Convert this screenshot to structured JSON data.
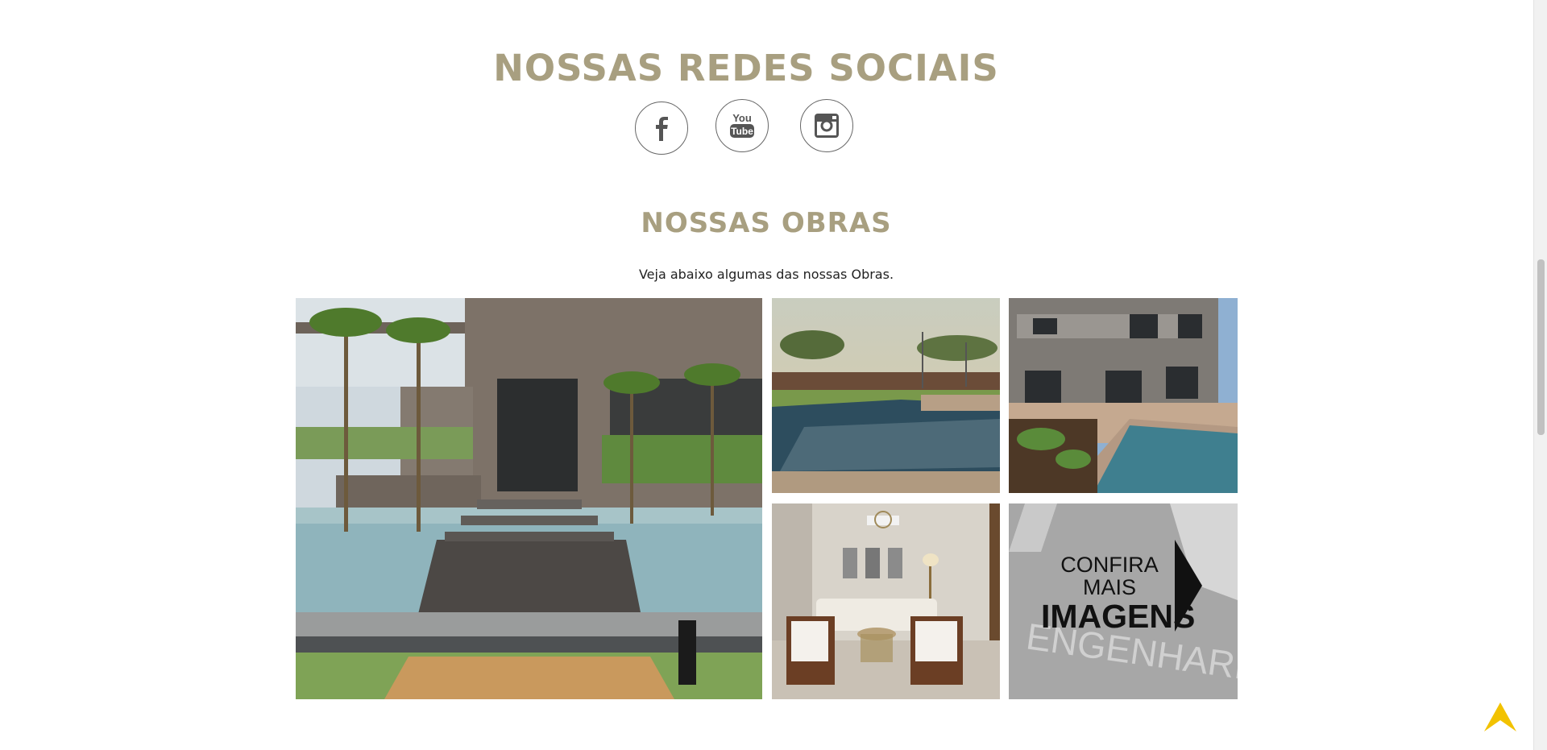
{
  "social": {
    "title": "NOSSAS REDES SOCIAIS",
    "links": [
      {
        "name": "Facebook",
        "icon": "facebook-icon"
      },
      {
        "name": "YouTube",
        "icon": "youtube-icon",
        "text_top": "You",
        "text_bottom": "Tube"
      },
      {
        "name": "Instagram",
        "icon": "instagram-icon"
      }
    ]
  },
  "obras": {
    "title": "NOSSAS OBRAS",
    "subtitle": "Veja abaixo algumas das nossas Obras.",
    "gallery": [
      {
        "subject": "modern house with reflecting pool and stepping stones"
      },
      {
        "subject": "swimming pool in garden"
      },
      {
        "subject": "two-story house with pool"
      },
      {
        "subject": "living room interior"
      }
    ],
    "more": {
      "line1": "CONFIRA MAIS",
      "line2": "IMAGENS",
      "background_text": "ENGENHARIA"
    }
  },
  "colors": {
    "heading": "#a89f80",
    "back_to_top": "#f2c200"
  },
  "back_to_top": {
    "icon": "arrow-up-icon"
  }
}
